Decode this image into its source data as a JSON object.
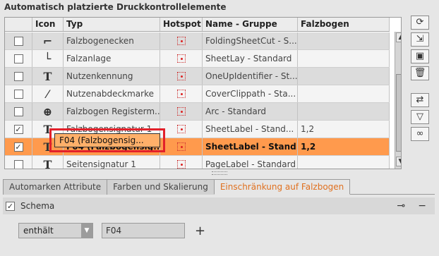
{
  "panel": {
    "title": "Automatisch platzierte Druckkontrollelemente"
  },
  "columns": [
    "",
    "Icon",
    "Typ",
    "Hotspot",
    "Name - Gruppe",
    "Falzbogen"
  ],
  "rows": [
    {
      "checked": false,
      "icon": "corner-icon",
      "typ": "Falzbogenecken",
      "name": "FoldingSheetCut - S...",
      "falzbogen": "",
      "style": "alt"
    },
    {
      "checked": false,
      "icon": "lay-icon",
      "typ": "Falzanlage",
      "name": "SheetLay - Standard",
      "falzbogen": "",
      "style": "white"
    },
    {
      "checked": false,
      "icon": "text-icon",
      "typ": "Nutzenkennung",
      "name": "OneUpIdentifier - St...",
      "falzbogen": "",
      "style": "alt"
    },
    {
      "checked": false,
      "icon": "magic-wand-icon",
      "typ": "Nutzenabdeckmarke",
      "name": "CoverClippath - Sta...",
      "falzbogen": "",
      "style": "white"
    },
    {
      "checked": false,
      "icon": "crosshair-icon",
      "typ": "Falzbogen Registerm...",
      "name": "Arc - Standard",
      "falzbogen": "",
      "style": "alt"
    },
    {
      "checked": true,
      "icon": "text-icon",
      "typ": "Falzbogensignatur 1",
      "name": "SheetLabel - Stand...",
      "falzbogen": "1,2",
      "style": "white"
    },
    {
      "checked": true,
      "icon": "text-icon",
      "typ": "F04 (Falzbogensig...",
      "name": "SheetLabel - Stand...",
      "falzbogen": "1,2",
      "style": "sel"
    },
    {
      "checked": false,
      "icon": "text-icon",
      "typ": "Seitensignatur 1",
      "name": "PageLabel - Standard",
      "falzbogen": "",
      "style": "white"
    }
  ],
  "check_mark": "✓",
  "edit_value": "F04 (Falzbogensig...",
  "toolbar": [
    "refresh-icon",
    "import-icon",
    "export-icon",
    "delete-icon",
    "swap-icon",
    "filter-icon",
    "link-icon"
  ],
  "tabs": [
    {
      "label": "Automarken Attribute",
      "active": false
    },
    {
      "label": "Farben und Skalierung",
      "active": false
    },
    {
      "label": "Einschränkung auf Falzbogen",
      "active": true
    }
  ],
  "schema": {
    "checked": true,
    "label": "Schema"
  },
  "filter": {
    "operator": "enthält",
    "value": "F04",
    "add": "+"
  }
}
